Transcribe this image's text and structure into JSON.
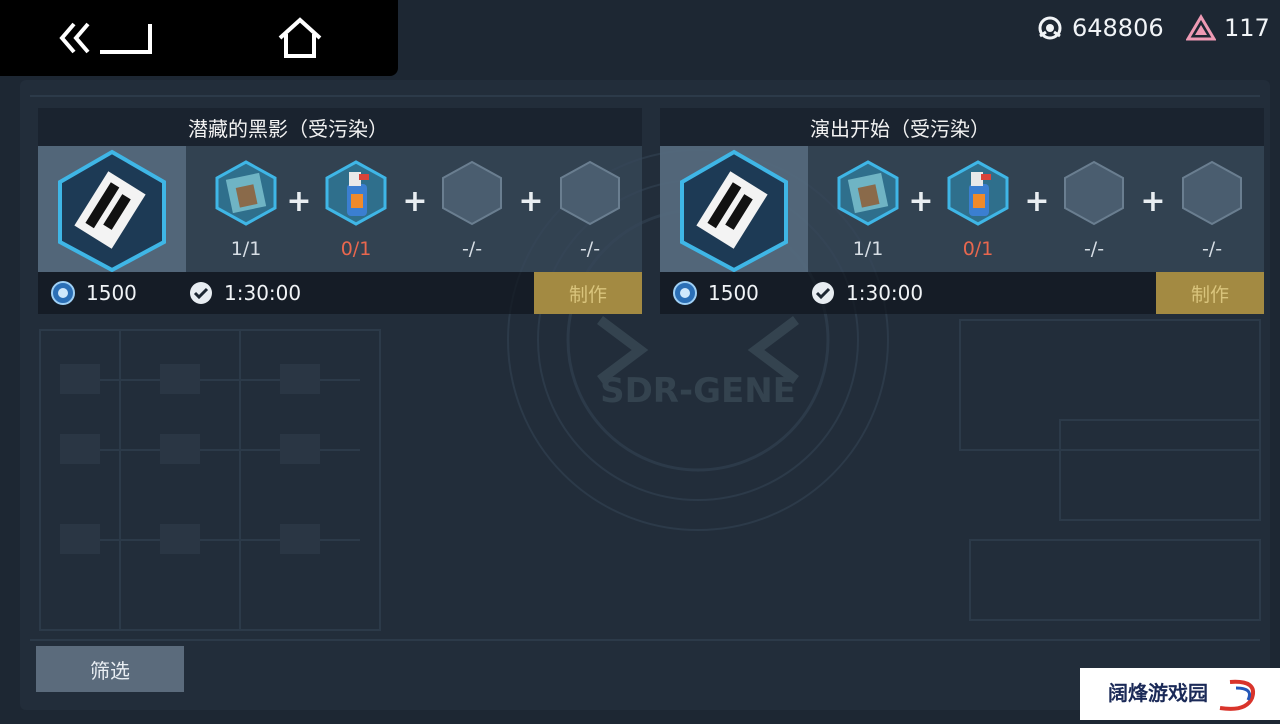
{
  "header": {
    "currency_1": {
      "icon": "gear-token-icon",
      "value": "648806"
    },
    "currency_2": {
      "icon": "triangle-gem-icon",
      "value": "117"
    }
  },
  "recipes": [
    {
      "title": "潜藏的黑影（受污染）",
      "product_icon": "sdr-ticket-icon",
      "materials": [
        {
          "icon": "blueprint-icon",
          "count": "1/1",
          "insufficient": false
        },
        {
          "icon": "spray-bottle-icon",
          "count": "0/1",
          "insufficient": true
        },
        {
          "icon": "empty-slot-icon",
          "count": "-/-",
          "insufficient": false
        },
        {
          "icon": "empty-slot-icon",
          "count": "-/-",
          "insufficient": false
        }
      ],
      "cost": "1500",
      "time": "1:30:00",
      "make_label": "制作"
    },
    {
      "title": "演出开始（受污染）",
      "product_icon": "sdr-ticket-icon",
      "materials": [
        {
          "icon": "blueprint-icon",
          "count": "1/1",
          "insufficient": false
        },
        {
          "icon": "spray-bottle-icon",
          "count": "0/1",
          "insufficient": true
        },
        {
          "icon": "empty-slot-icon",
          "count": "-/-",
          "insufficient": false
        },
        {
          "icon": "empty-slot-icon",
          "count": "-/-",
          "insufficient": false
        }
      ],
      "cost": "1500",
      "time": "1:30:00",
      "make_label": "制作"
    }
  ],
  "background_logo": "SDR-GENE",
  "filter_label": "筛选",
  "watermark": "阔烽游戏园",
  "colors": {
    "background": "#1d2733",
    "accent_gold": "#a38a42",
    "insufficient_red": "#e8674e",
    "hex_blue": "#3fb6e6"
  }
}
